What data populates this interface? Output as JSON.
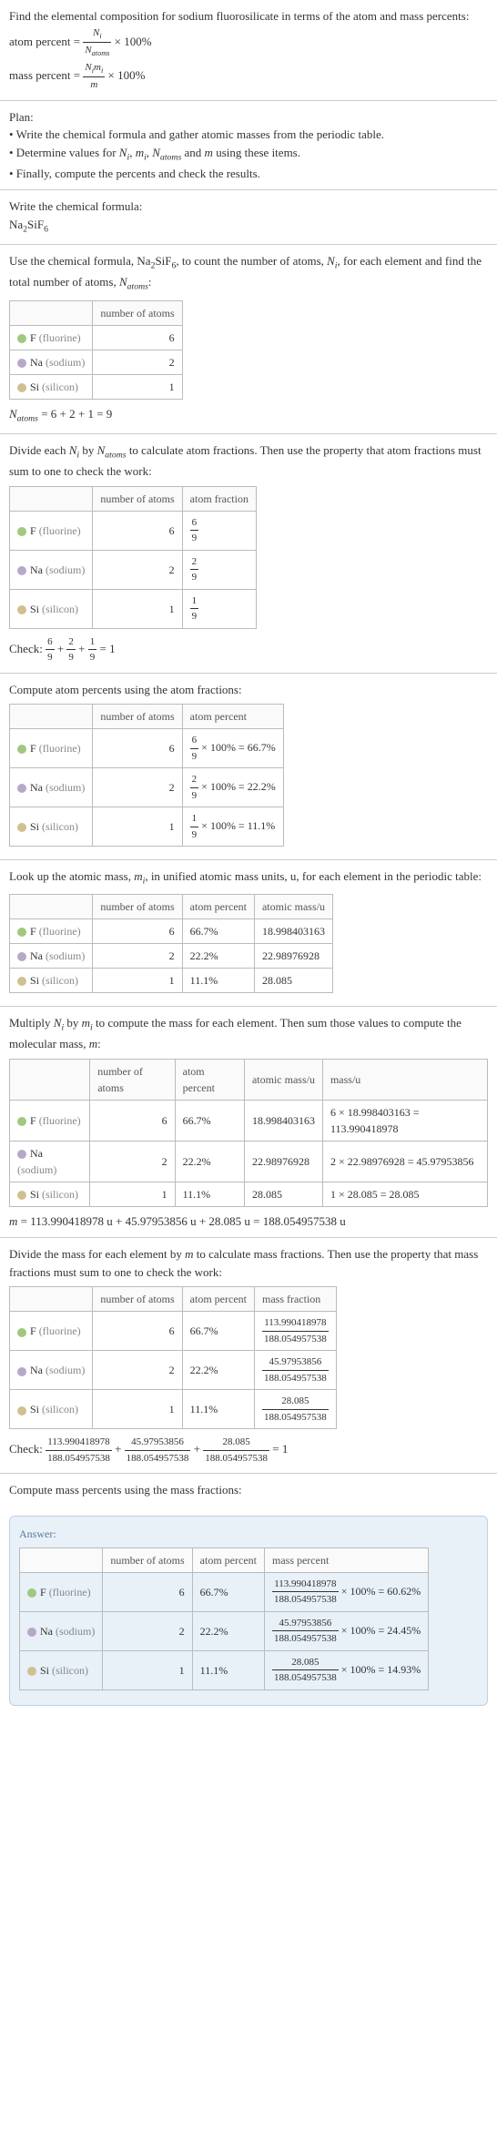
{
  "intro": {
    "line1": "Find the elemental composition for sodium fluorosilicate in terms of the atom and mass percents:",
    "atom_percent_label": "atom percent = ",
    "atom_percent_frac_num": "N_i",
    "atom_percent_frac_den": "N_atoms",
    "times100": " × 100%",
    "mass_percent_label": "mass percent = ",
    "mass_percent_frac_num": "N_i m_i",
    "mass_percent_frac_den": "m"
  },
  "plan": {
    "title": "Plan:",
    "b1": "• Write the chemical formula and gather atomic masses from the periodic table.",
    "b2_a": "• Determine values for ",
    "b2_b": " using these items.",
    "b3": "• Finally, compute the percents and check the results."
  },
  "write_formula": {
    "title": "Write the chemical formula:",
    "formula_prefix": "Na",
    "formula_sub1": "2",
    "formula_mid": "SiF",
    "formula_sub2": "6"
  },
  "count_atoms": {
    "text_a": "Use the chemical formula, Na",
    "text_b": "SiF",
    "text_c": ", to count the number of atoms, ",
    "text_d": ", for each element and find the total number of atoms, ",
    "text_e": ":",
    "col1": "number of atoms",
    "rows": [
      {
        "name": "F",
        "label": "(fluorine)",
        "n": "6"
      },
      {
        "name": "Na",
        "label": "(sodium)",
        "n": "2"
      },
      {
        "name": "Si",
        "label": "(silicon)",
        "n": "1"
      }
    ],
    "sum": " = 6 + 2 + 1 = 9"
  },
  "atom_frac": {
    "text": "Divide each N_i by N_atoms to calculate atom fractions. Then use the property that atom fractions must sum to one to check the work:",
    "col1": "number of atoms",
    "col2": "atom fraction",
    "rows": [
      {
        "name": "F",
        "label": "(fluorine)",
        "n": "6",
        "fn": "6",
        "fd": "9"
      },
      {
        "name": "Na",
        "label": "(sodium)",
        "n": "2",
        "fn": "2",
        "fd": "9"
      },
      {
        "name": "Si",
        "label": "(silicon)",
        "n": "1",
        "fn": "1",
        "fd": "9"
      }
    ],
    "check_label": "Check: ",
    "check_eq": " = 1"
  },
  "atom_pct": {
    "text": "Compute atom percents using the atom fractions:",
    "col1": "number of atoms",
    "col2": "atom percent",
    "rows": [
      {
        "name": "F",
        "label": "(fluorine)",
        "n": "6",
        "fn": "6",
        "fd": "9",
        "pct": " × 100% = 66.7%"
      },
      {
        "name": "Na",
        "label": "(sodium)",
        "n": "2",
        "fn": "2",
        "fd": "9",
        "pct": " × 100% = 22.2%"
      },
      {
        "name": "Si",
        "label": "(silicon)",
        "n": "1",
        "fn": "1",
        "fd": "9",
        "pct": " × 100% = 11.1%"
      }
    ]
  },
  "atomic_mass": {
    "text": "Look up the atomic mass, m_i, in unified atomic mass units, u, for each element in the periodic table:",
    "col1": "number of atoms",
    "col2": "atom percent",
    "col3": "atomic mass/u",
    "rows": [
      {
        "name": "F",
        "label": "(fluorine)",
        "n": "6",
        "pct": "66.7%",
        "mass": "18.998403163"
      },
      {
        "name": "Na",
        "label": "(sodium)",
        "n": "2",
        "pct": "22.2%",
        "mass": "22.98976928"
      },
      {
        "name": "Si",
        "label": "(silicon)",
        "n": "1",
        "pct": "11.1%",
        "mass": "28.085"
      }
    ]
  },
  "multiply": {
    "text": "Multiply N_i by m_i to compute the mass for each element. Then sum those values to compute the molecular mass, m:",
    "col1": "number of atoms",
    "col2": "atom percent",
    "col3": "atomic mass/u",
    "col4": "mass/u",
    "rows": [
      {
        "name": "F",
        "label": "(fluorine)",
        "n": "6",
        "pct": "66.7%",
        "mass": "18.998403163",
        "calc": "6 × 18.998403163 = 113.990418978"
      },
      {
        "name": "Na",
        "label": "(sodium)",
        "n": "2",
        "pct": "22.2%",
        "mass": "22.98976928",
        "calc": "2 × 22.98976928 = 45.97953856"
      },
      {
        "name": "Si",
        "label": "(silicon)",
        "n": "1",
        "pct": "11.1%",
        "mass": "28.085",
        "calc": "1 × 28.085 = 28.085"
      }
    ],
    "sum": "m = 113.990418978 u + 45.97953856 u + 28.085 u = 188.054957538 u"
  },
  "mass_frac": {
    "text": "Divide the mass for each element by m to calculate mass fractions. Then use the property that mass fractions must sum to one to check the work:",
    "col1": "number of atoms",
    "col2": "atom percent",
    "col3": "mass fraction",
    "rows": [
      {
        "name": "F",
        "label": "(fluorine)",
        "n": "6",
        "pct": "66.7%",
        "fn": "113.990418978",
        "fd": "188.054957538"
      },
      {
        "name": "Na",
        "label": "(sodium)",
        "n": "2",
        "pct": "22.2%",
        "fn": "45.97953856",
        "fd": "188.054957538"
      },
      {
        "name": "Si",
        "label": "(silicon)",
        "n": "1",
        "pct": "11.1%",
        "fn": "28.085",
        "fd": "188.054957538"
      }
    ],
    "check_label": "Check: ",
    "check_eq": " = 1"
  },
  "mass_pct": {
    "text": "Compute mass percents using the mass fractions:"
  },
  "answer": {
    "label": "Answer:",
    "col1": "number of atoms",
    "col2": "atom percent",
    "col3": "mass percent",
    "rows": [
      {
        "name": "F",
        "label": "(fluorine)",
        "n": "6",
        "pct": "66.7%",
        "fn": "113.990418978",
        "fd": "188.054957538",
        "res": " × 100% = 60.62%"
      },
      {
        "name": "Na",
        "label": "(sodium)",
        "n": "2",
        "pct": "22.2%",
        "fn": "45.97953856",
        "fd": "188.054957538",
        "res": " × 100% = 24.45%"
      },
      {
        "name": "Si",
        "label": "(silicon)",
        "n": "1",
        "pct": "11.1%",
        "fn": "28.085",
        "fd": "188.054957538",
        "res": " × 100% = 14.93%"
      }
    ]
  }
}
